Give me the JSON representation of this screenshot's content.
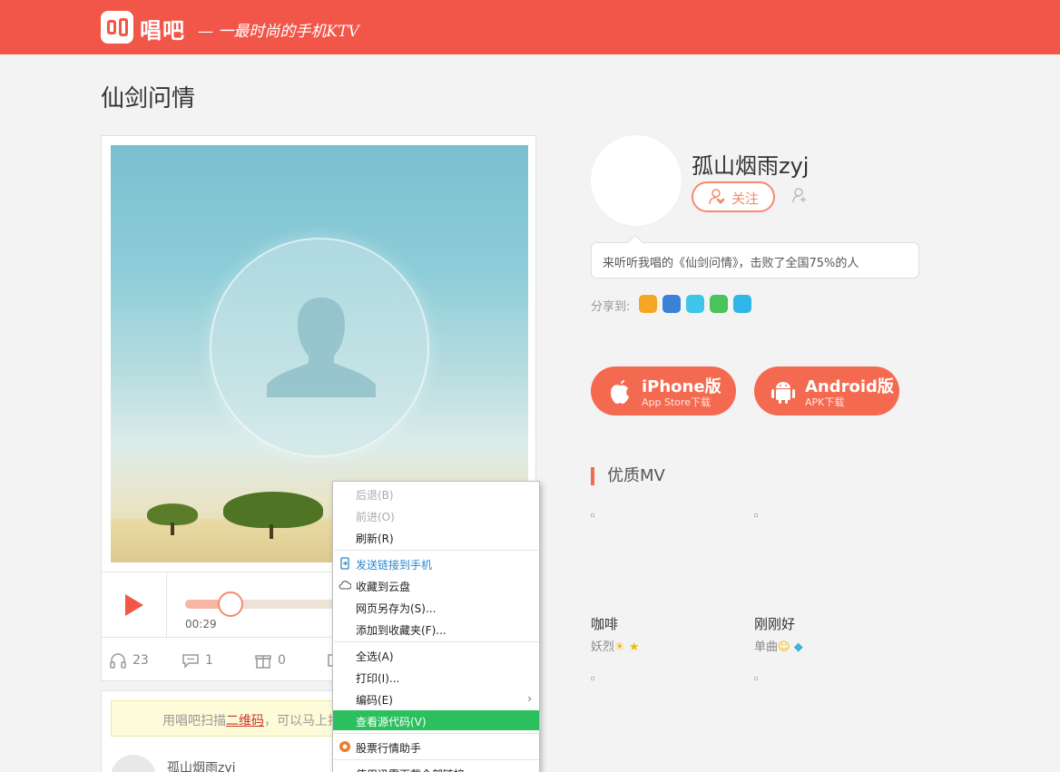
{
  "header": {
    "brand": "唱吧",
    "slogan": "— 一最时尚的手机KTV"
  },
  "song": {
    "title": "仙剑问情"
  },
  "player": {
    "current_time": "00:29",
    "progress_fraction": 0.16,
    "stats": {
      "listens": "23",
      "comments": "1",
      "gifts": "0"
    }
  },
  "comment_area": {
    "notice_prefix": "用唱吧扫描",
    "notice_link": "二维码",
    "notice_suffix": "，可以马上抖",
    "commenter_name": "孤山烟雨zyj"
  },
  "singer": {
    "name": "孤山烟雨zyj",
    "follow_label": "关注",
    "bubble_text": "来听听我唱的《仙剑问情》，击败了全国75%的人",
    "share_label": "分享到:",
    "share_targets": [
      {
        "name": "weibo",
        "color": "#f5a623"
      },
      {
        "name": "qq-favorite",
        "color": "#3b82d6"
      },
      {
        "name": "tencent-weibo",
        "color": "#3ec5e8"
      },
      {
        "name": "wechat",
        "color": "#4cc35a"
      },
      {
        "name": "qq",
        "color": "#2fb5ea"
      }
    ]
  },
  "downloads": {
    "iphone_title": "iPhone版",
    "iphone_sub": "App Store下载",
    "android_title": "Android版",
    "android_sub": "APK下载"
  },
  "mv": {
    "header": "优质MV",
    "items": [
      {
        "title": "咖啡",
        "singer": "妖烈"
      },
      {
        "title": "刚刚好",
        "singer": "单曲"
      }
    ]
  },
  "context_menu": {
    "back": "后退(B)",
    "forward": "前进(O)",
    "refresh": "刷新(R)",
    "send_to_phone": "发送链接到手机",
    "save_to_cloud": "收藏到云盘",
    "save_page_as": "网页另存为(S)...",
    "add_favorite": "添加到收藏夹(F)...",
    "select_all": "全选(A)",
    "print": "打印(I)...",
    "encoding": "编码(E)",
    "view_source": "查看源代码(V)",
    "stock_helper": "股票行情助手",
    "download_all": "使用迅雷下载全部链接"
  },
  "colors": {
    "brand_red": "#f25648",
    "accent_orange": "#f46a50",
    "menu_highlight": "#2bbf5d"
  }
}
